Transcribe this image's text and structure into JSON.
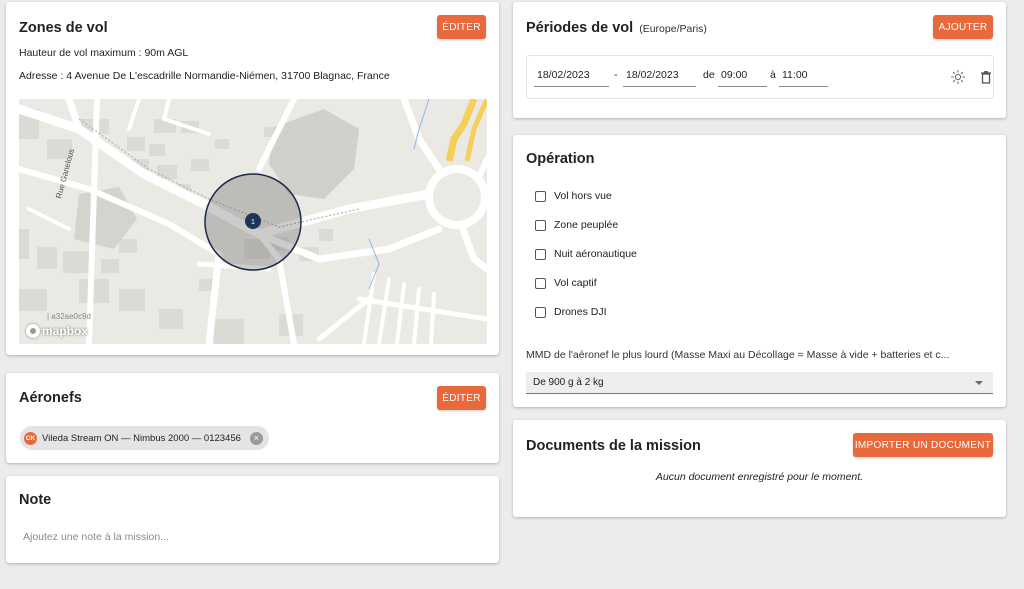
{
  "zones": {
    "title": "Zones de vol",
    "edit_label": "ÉDITER",
    "max_height": "Hauteur de vol maximum : 90m AGL",
    "address": "Adresse : 4 Avenue De L'escadrille Normandie-Niémen, 31700 Blagnac, France",
    "map": {
      "street_label": "Rue Ganelous",
      "marker_number": "1",
      "attribution": "| a32ae0c9d",
      "logo": "mapbox"
    }
  },
  "aeronefs": {
    "title": "Aéronefs",
    "edit_label": "ÉDITER",
    "chip_avatar": "CK",
    "chip_label": "Vileda Stream ON — Nimbus 2000 — 0123456"
  },
  "note": {
    "title": "Note",
    "placeholder": "Ajoutez une note à la mission..."
  },
  "periodes": {
    "title": "Périodes de vol",
    "timezone": "(Europe/Paris)",
    "add_label": "AJOUTER",
    "rows": [
      {
        "start_date": "18/02/2023",
        "dash": "-",
        "end_date": "18/02/2023",
        "from_label": "de",
        "start_time": "09:00",
        "to_label": "à",
        "end_time": "11:00"
      }
    ],
    "icons": [
      "sun-icon",
      "trash-icon"
    ]
  },
  "operation": {
    "title": "Opération",
    "options": [
      {
        "label": "Vol hors vue",
        "checked": false
      },
      {
        "label": "Zone peuplée",
        "checked": false
      },
      {
        "label": "Nuit aéronautique",
        "checked": false
      },
      {
        "label": "Vol captif",
        "checked": false
      },
      {
        "label": "Drones DJI",
        "checked": false
      }
    ],
    "mmd_label": "MMD de l'aéronef le plus lourd (Masse Maxi au Décollage = Masse à vide + batteries et c...",
    "mmd_value": "De 900 g à 2 kg"
  },
  "documents": {
    "title": "Documents de la mission",
    "import_label": "IMPORTER UN DOCUMENT",
    "empty_text": "Aucun document enregistré pour le moment."
  },
  "colors": {
    "accent": "#e8693b",
    "background": "#ececec",
    "card": "#ffffff"
  }
}
